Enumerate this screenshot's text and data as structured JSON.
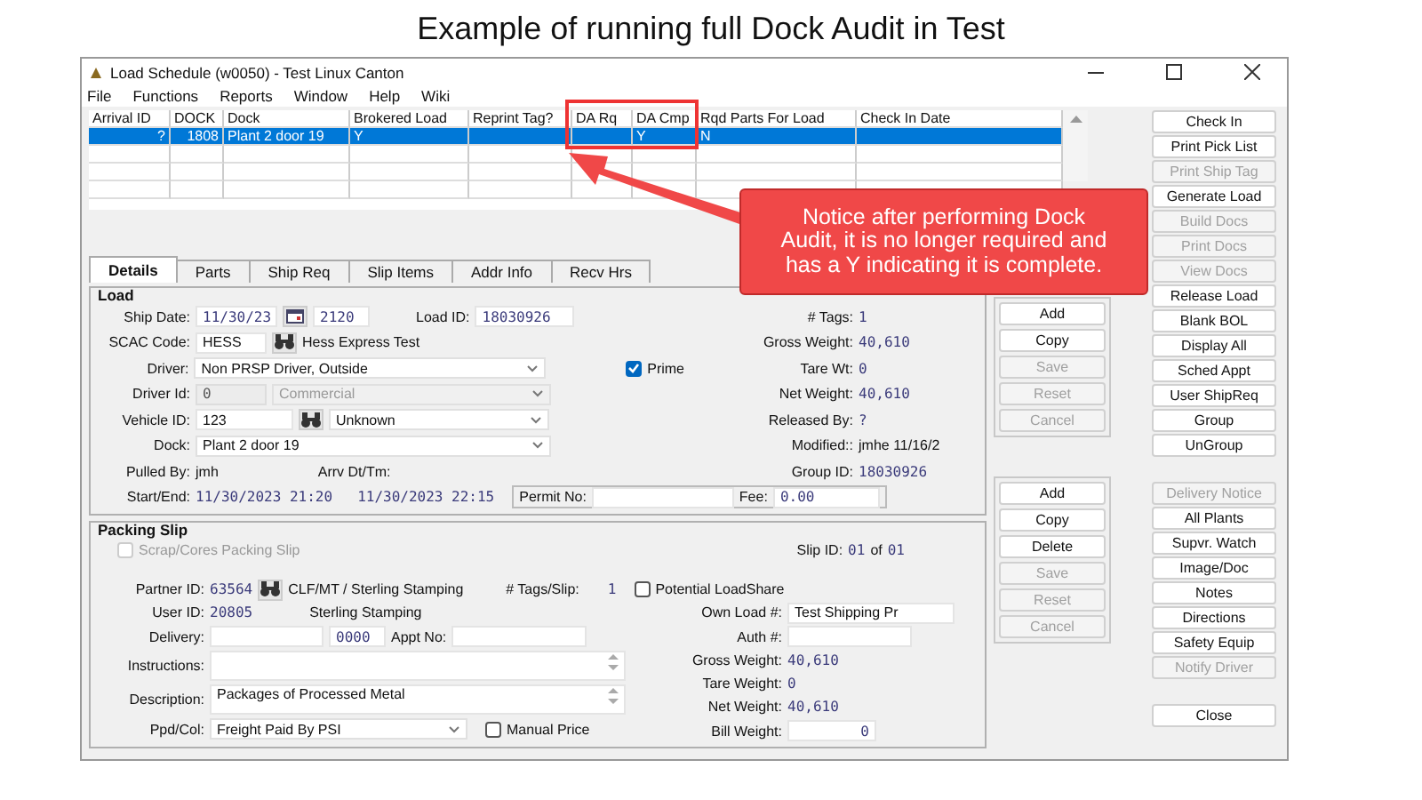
{
  "slide_title": "Example of running full Dock Audit in Test",
  "window": {
    "title": "Load Schedule (w0050) - Test Linux Canton"
  },
  "menu": [
    "File",
    "Functions",
    "Reports",
    "Window",
    "Help",
    "Wiki"
  ],
  "grid": {
    "columns": [
      "Arrival ID",
      "DOCK",
      "Dock",
      "Brokered Load",
      "Reprint Tag?",
      "DA Rq",
      "DA Cmp",
      "Rqd Parts For Load",
      "Check In Date"
    ],
    "rows": [
      {
        "selected": true,
        "cells": [
          "?",
          "1808",
          "Plant 2 door 19",
          "Y",
          null,
          null,
          "Y",
          "N",
          null
        ]
      }
    ]
  },
  "callout": {
    "text": "Notice after performing Dock Audit, it is no longer required and has a Y indicating it is complete."
  },
  "tabs": [
    {
      "label": "Details",
      "selected": true
    },
    {
      "label": "Parts",
      "selected": false
    },
    {
      "label": "Ship Req",
      "selected": false
    },
    {
      "label": "Slip Items",
      "selected": false
    },
    {
      "label": "Addr Info",
      "selected": false
    },
    {
      "label": "Recv Hrs",
      "selected": false
    }
  ],
  "load": {
    "title": "Load",
    "ship_date": {
      "label": "Ship Date:",
      "value": "11/30/23",
      "time": "2120"
    },
    "load_id": {
      "label": "Load ID:",
      "value": "18030926"
    },
    "scac": {
      "label": "SCAC Code:",
      "value": "HESS",
      "name": "Hess Express Test"
    },
    "driver": {
      "label": "Driver:",
      "value": "Non PRSP Driver, Outside"
    },
    "prime": {
      "label": "Prime",
      "checked": true
    },
    "driver_id": {
      "label": "Driver Id:",
      "value": "0",
      "type": "Commercial",
      "disabled": true
    },
    "vehicle": {
      "label": "Vehicle ID:",
      "value": "123",
      "type": "Unknown"
    },
    "dock": {
      "label": "Dock:",
      "value": "Plant 2 door 19"
    },
    "pulled_by": {
      "label": "Pulled By:",
      "value": "jmh"
    },
    "arrival": {
      "label": "Arrv Dt/Tm:"
    },
    "start_end": {
      "label": "Start/End:",
      "start": "11/30/2023 21:20",
      "end": "11/30/2023 22:15"
    },
    "permit": {
      "label": "Permit No:"
    },
    "fee": {
      "label": "Fee:",
      "value": "0.00"
    },
    "stats": [
      {
        "label": "# Tags:",
        "value": "1"
      },
      {
        "label": "Gross Weight:",
        "value": "40,610"
      },
      {
        "label": "Tare Wt:",
        "value": "0"
      },
      {
        "label": "Net Weight:",
        "value": "40,610"
      },
      {
        "label": "Released By:",
        "value": "?"
      },
      {
        "label": "Modified::",
        "value": "jmhe 11/16/2"
      },
      {
        "label": "Group ID:",
        "value": "18030926"
      }
    ],
    "buttons": [
      {
        "label": "Add",
        "disabled": false
      },
      {
        "label": "Copy",
        "disabled": false
      },
      {
        "label": "Save",
        "disabled": true
      },
      {
        "label": "Reset",
        "disabled": true
      },
      {
        "label": "Cancel",
        "disabled": true
      }
    ]
  },
  "packing": {
    "title": "Packing Slip",
    "scrap": {
      "label": "Scrap/Cores Packing Slip",
      "checked": false,
      "disabled": true
    },
    "slip_id": {
      "label": "Slip ID:",
      "value": "01",
      "of": "of",
      "total": "01"
    },
    "partner": {
      "label": "Partner ID:",
      "value": "63564",
      "name": "CLF/MT / Sterling Stamping"
    },
    "tags_per_slip": {
      "label": "# Tags/Slip:",
      "value": "1"
    },
    "loadshare": {
      "label": "Potential LoadShare",
      "checked": false
    },
    "user": {
      "label": "User ID:",
      "value": "20805",
      "name": "Sterling Stamping"
    },
    "own_load": {
      "label": "Own Load #:",
      "value": "Test Shipping Pr"
    },
    "delivery": {
      "label": "Delivery:",
      "code": "0000"
    },
    "appt": {
      "label": "Appt No:"
    },
    "auth": {
      "label": "Auth #:"
    },
    "instructions": {
      "label": "Instructions:"
    },
    "description": {
      "label": "Description:",
      "value": "Packages of Processed Metal"
    },
    "ppd_col": {
      "label": "Ppd/Col:",
      "value": "Freight Paid By PSI"
    },
    "manual_price": {
      "label": "Manual Price",
      "checked": false
    },
    "weights": [
      {
        "label": "Gross Weight:",
        "value": "40,610"
      },
      {
        "label": "Tare Weight:",
        "value": "0"
      },
      {
        "label": "Net Weight:",
        "value": "40,610"
      }
    ],
    "bill_weight": {
      "label": "Bill Weight:",
      "value": "0"
    },
    "buttons": [
      {
        "label": "Add",
        "disabled": false
      },
      {
        "label": "Copy",
        "disabled": false
      },
      {
        "label": "Delete",
        "disabled": false
      },
      {
        "label": "Save",
        "disabled": true
      },
      {
        "label": "Reset",
        "disabled": true
      },
      {
        "label": "Cancel",
        "disabled": true
      }
    ]
  },
  "side_groups": [
    {
      "buttons": [
        {
          "label": "Check In",
          "disabled": false
        },
        {
          "label": "Print Pick List",
          "disabled": false
        },
        {
          "label": "Print Ship Tag",
          "disabled": true
        },
        {
          "label": "Generate Load",
          "disabled": false
        },
        {
          "label": "Build Docs",
          "disabled": true
        },
        {
          "label": "Print Docs",
          "disabled": true
        },
        {
          "label": "View Docs",
          "disabled": true
        },
        {
          "label": "Release Load",
          "disabled": false
        },
        {
          "label": "Blank BOL",
          "disabled": false
        },
        {
          "label": "Display All",
          "disabled": false
        },
        {
          "label": "Sched Appt",
          "disabled": false
        },
        {
          "label": "User ShipReq",
          "disabled": false
        },
        {
          "label": "Group",
          "disabled": false
        },
        {
          "label": "UnGroup",
          "disabled": false
        }
      ]
    },
    {
      "buttons": [
        {
          "label": "Delivery Notice",
          "disabled": true
        },
        {
          "label": "All Plants",
          "disabled": false
        },
        {
          "label": "Supvr. Watch",
          "disabled": false
        },
        {
          "label": "Image/Doc",
          "disabled": false
        },
        {
          "label": "Notes",
          "disabled": false
        },
        {
          "label": "Directions",
          "disabled": false
        },
        {
          "label": "Safety Equip",
          "disabled": false
        },
        {
          "label": "Notify Driver",
          "disabled": true
        }
      ]
    },
    {
      "buttons": [
        {
          "label": "Close",
          "disabled": false
        }
      ]
    }
  ]
}
